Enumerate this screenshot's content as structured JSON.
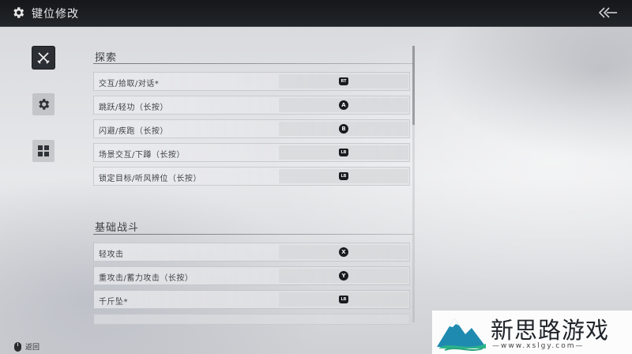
{
  "header": {
    "title": "键位修改"
  },
  "sections": [
    {
      "title": "探索",
      "rows": [
        {
          "label": "交互/拾取/对话*",
          "key": "RT"
        },
        {
          "label": "跳跃/轻功（长按）",
          "key": "A"
        },
        {
          "label": "闪避/疾跑（长按）",
          "key": "B"
        },
        {
          "label": "场景交互/下蹲（长按）",
          "key": "LB"
        },
        {
          "label": "锁定目标/听风辨位（长按）",
          "key": "LB"
        }
      ]
    },
    {
      "title": "基础战斗",
      "rows": [
        {
          "label": "轻攻击",
          "key": "X"
        },
        {
          "label": "重攻击/蓄力攻击（长按）",
          "key": "Y"
        },
        {
          "label": "千斤坠*",
          "key": "LB"
        }
      ]
    }
  ],
  "footer": {
    "back_label": "返回"
  },
  "watermark": {
    "brand": "新思路游戏",
    "domain": "—www.xslgy.com—"
  },
  "icons": {
    "header": "gear-icon",
    "back": "double-chevron-back-icon",
    "sidebar": [
      "crossed-swords-icon",
      "gear-icon",
      "grid-icon"
    ],
    "footer": "mouse-icon"
  },
  "colors": {
    "header_bg": "#1b1d20",
    "key_bg": "#1a1b1e",
    "active_tab": "#2b2e33"
  }
}
